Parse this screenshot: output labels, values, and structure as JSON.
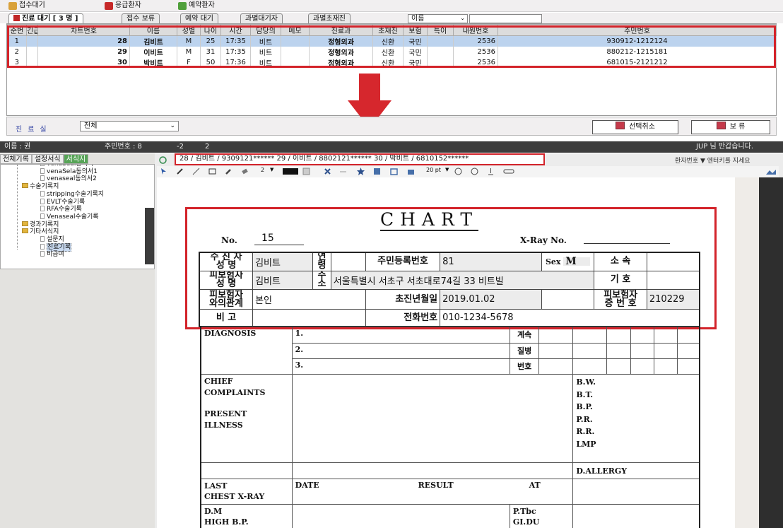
{
  "toolbar": {
    "btn_reception_wait": "접수대기",
    "btn_emergency": "응급환자",
    "btn_reservation": "예약환자",
    "icon_colors": {
      "reception": "#d9a13a",
      "emergency": "#c62828",
      "reservation": "#4f9f3a"
    }
  },
  "tabs": [
    {
      "label": "진료 대기 [ 3 명 ]",
      "active": true
    },
    {
      "label": "접수 보류"
    },
    {
      "label": "예약 대기"
    },
    {
      "label": "과별대기자"
    },
    {
      "label": "과별초재진"
    }
  ],
  "search": {
    "select_value": "이름",
    "input_value": ""
  },
  "waiting_table": {
    "headers": [
      "순번",
      "긴급",
      "차트번호",
      "이름",
      "성별",
      "나이",
      "시간",
      "담당의",
      "메모",
      "진료과",
      "초재진",
      "보험",
      "특이",
      "내원번호",
      "주민번호"
    ],
    "rows": [
      {
        "seq": "1",
        "urgent": "",
        "chart": "28",
        "name": "김비트",
        "sex": "M",
        "age": "25",
        "time": "17:35",
        "doctor": "비트",
        "memo": "",
        "dept": "정형외과",
        "visit": "신환",
        "ins": "국민",
        "special": "",
        "visit_no": "2536",
        "rrn": "930912-1212124"
      },
      {
        "seq": "2",
        "urgent": "",
        "chart": "29",
        "name": "이비트",
        "sex": "M",
        "age": "31",
        "time": "17:35",
        "doctor": "비트",
        "memo": "",
        "dept": "정형외과",
        "visit": "신환",
        "ins": "국민",
        "special": "",
        "visit_no": "2536",
        "rrn": "880212-1215181"
      },
      {
        "seq": "3",
        "urgent": "",
        "chart": "30",
        "name": "박비트",
        "sex": "F",
        "age": "50",
        "time": "17:36",
        "doctor": "비트",
        "memo": "",
        "dept": "정형외과",
        "visit": "신환",
        "ins": "국민",
        "special": "",
        "visit_no": "2536",
        "rrn": "681015-2121212"
      }
    ],
    "selected_row": 0
  },
  "filter": {
    "label": "진료실",
    "dept_value": "전체",
    "btn_cancel_select": "선택취소",
    "btn_hold": "보  류"
  },
  "statusbar": {
    "name_label": "이름 : 권",
    "rrn_label": "주민번호 : 8",
    "num1": "-2",
    "num2": "2",
    "greeting": "JUP 님 반갑습니다."
  },
  "left_tabs": [
    "전체기록",
    "설정서식",
    "서식지"
  ],
  "tree": [
    {
      "label": "venaSeal동의서",
      "kind": "doc",
      "level": 3
    },
    {
      "label": "venaSela동의서1",
      "kind": "doc",
      "level": 3
    },
    {
      "label": "venaseal동의서2",
      "kind": "doc",
      "level": 3
    },
    {
      "label": "수술기록지",
      "kind": "folder",
      "level": 2
    },
    {
      "label": "stripping수술기록지",
      "kind": "doc",
      "level": 3
    },
    {
      "label": "EVLT수술기록",
      "kind": "doc",
      "level": 3
    },
    {
      "label": "RFA수술기록",
      "kind": "doc",
      "level": 3
    },
    {
      "label": "Venaseal수술기록",
      "kind": "doc",
      "level": 3
    },
    {
      "label": "경과기록지",
      "kind": "folder",
      "level": 2
    },
    {
      "label": "기타서식지",
      "kind": "folder",
      "level": 2
    },
    {
      "label": "설문지",
      "kind": "doc",
      "level": 3
    },
    {
      "label": "진료기록",
      "kind": "doc",
      "level": 3,
      "selected": true
    },
    {
      "label": "비급여",
      "kind": "doc",
      "level": 3
    }
  ],
  "patient_bar": "28 / 김비트 / 9309121******      29 / 이비트 / 8802121******      30 / 박비트 / 6810152******",
  "patient_search_hint": "환자번호 ▼ 엔터키를 지세요",
  "zoom": {
    "pen_size": "2",
    "font_size": "20 pt"
  },
  "chart_form": {
    "title": "CHART",
    "no_label": "No.",
    "no_value": "15",
    "xray_label": "X-Ray No.",
    "patient_name_label": "수 진 자\n성    명",
    "patient_name": "김비트",
    "age_label": "연\n령",
    "age_value": "",
    "rrn_label": "주민등록번호",
    "rrn_value": "81",
    "sex_label": "Sex",
    "sex_value": "M",
    "affil_label": "소    속",
    "insured_label": "피보험자\n성    명",
    "insured_name": "김비트",
    "address_label": "주\n소",
    "address": "서울특별시 서초구 서초대로74길 33 비트빌",
    "symbol_label": "기    호",
    "relation_label": "피보험자\n와의관계",
    "relation_value": "본인",
    "first_visit_label": "초진년월일",
    "first_visit": "2019.01.02",
    "card_no_label": "피보험자\n증 번 호",
    "card_no": "210229",
    "remark_label": "비    고",
    "phone_label": "전화번호",
    "phone": "010-1234-5678",
    "diagnosis_label": "DIAGNOSIS",
    "diag_items": [
      "1.",
      "2.",
      "3."
    ],
    "code_labels": [
      "계속",
      "질병",
      "번호"
    ],
    "chief_label": "CHIEF\nCOMPLAINTS",
    "present_label": "PRESENT\nILLNESS",
    "vitals": [
      "B.W.",
      "B.T.",
      "B.P.",
      "P.R.",
      "R.R.",
      "LMP"
    ],
    "allergy_label": "D.ALLERGY",
    "last_label": "LAST\nCHEST X-RAY",
    "date_label": "DATE",
    "result_label": "RESULT",
    "at_label": "AT",
    "dm_label": "D.M\nHIGH B.P.",
    "ptbc_label": "P.Tbc\nGI.DU"
  },
  "colors": {
    "highlight_red": "#d3232a",
    "selected_row": "#bcd3ee"
  }
}
